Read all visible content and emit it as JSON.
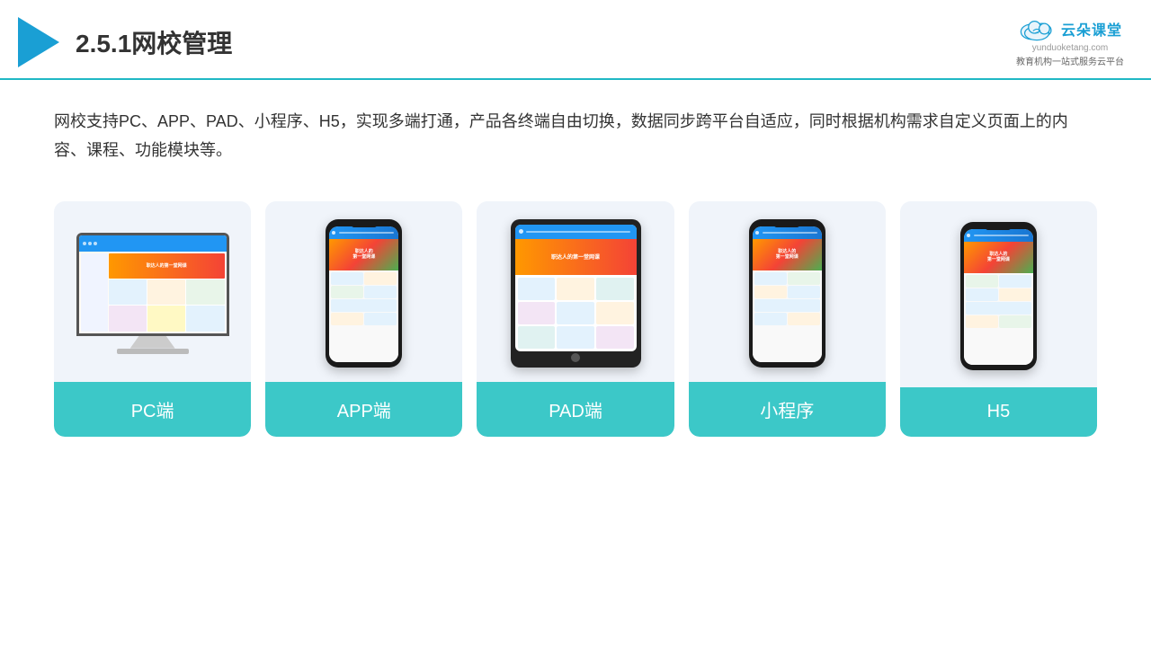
{
  "header": {
    "title": "2.5.1网校管理",
    "brand_name": "云朵课堂",
    "brand_url": "yunduoketang.com",
    "brand_subtitle": "教育机构一站式服务云平台"
  },
  "description": "网校支持PC、APP、PAD、小程序、H5，实现多端打通，产品各终端自由切换，数据同步跨平台自适应，同时根据机构需求自定义页面上的内容、课程、功能模块等。",
  "cards": [
    {
      "id": "pc",
      "label": "PC端"
    },
    {
      "id": "app",
      "label": "APP端"
    },
    {
      "id": "pad",
      "label": "PAD端"
    },
    {
      "id": "miniapp",
      "label": "小程序"
    },
    {
      "id": "h5",
      "label": "H5"
    }
  ]
}
